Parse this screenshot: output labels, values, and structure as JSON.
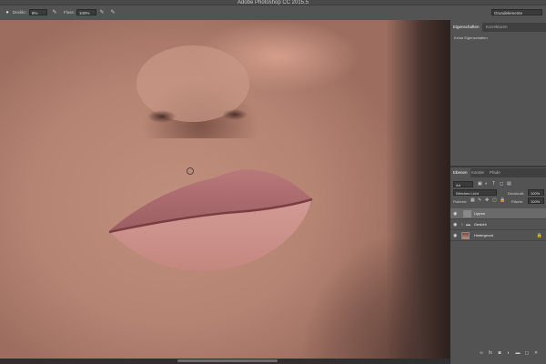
{
  "app": {
    "title": "Adobe Photoshop CC 2015.5",
    "workspace": "Grundelemente"
  },
  "options_bar": {
    "size_label": "Deckkr.:",
    "size_value": "8%",
    "flow_label": "Fluss:",
    "flow_value": "100%"
  },
  "properties_panel": {
    "tabs": [
      "Eigenschaften",
      "Korrekturen"
    ],
    "empty_text": "Keine Eigenschaften"
  },
  "layers_panel": {
    "tabs": [
      "Ebenen",
      "Kanäle",
      "Pfade"
    ],
    "filter_value": "Art",
    "blend_mode": "Weiches Licht",
    "opacity_label": "Deckkraft:",
    "opacity_value": "100%",
    "lock_label": "Fixieren:",
    "fill_label": "Fläche:",
    "fill_value": "100%",
    "layers": [
      {
        "name": "Lippen",
        "selected": true,
        "type": "adjustment"
      },
      {
        "name": "Gesicht",
        "selected": false,
        "type": "group"
      },
      {
        "name": "Hintergrund",
        "selected": false,
        "type": "image",
        "locked": true
      }
    ]
  },
  "icons": {
    "brush_settings": "brush-settings-icon",
    "airbrush": "airbrush-icon",
    "pressure": "pressure-icon",
    "eye": "eye-icon",
    "lock": "lock-icon",
    "folder": "folder-icon"
  },
  "colors": {
    "panel_bg": "#535353",
    "canvas_skin": "#b68473",
    "lip": "#c98a84",
    "selected_layer": "#6a6a6a"
  }
}
